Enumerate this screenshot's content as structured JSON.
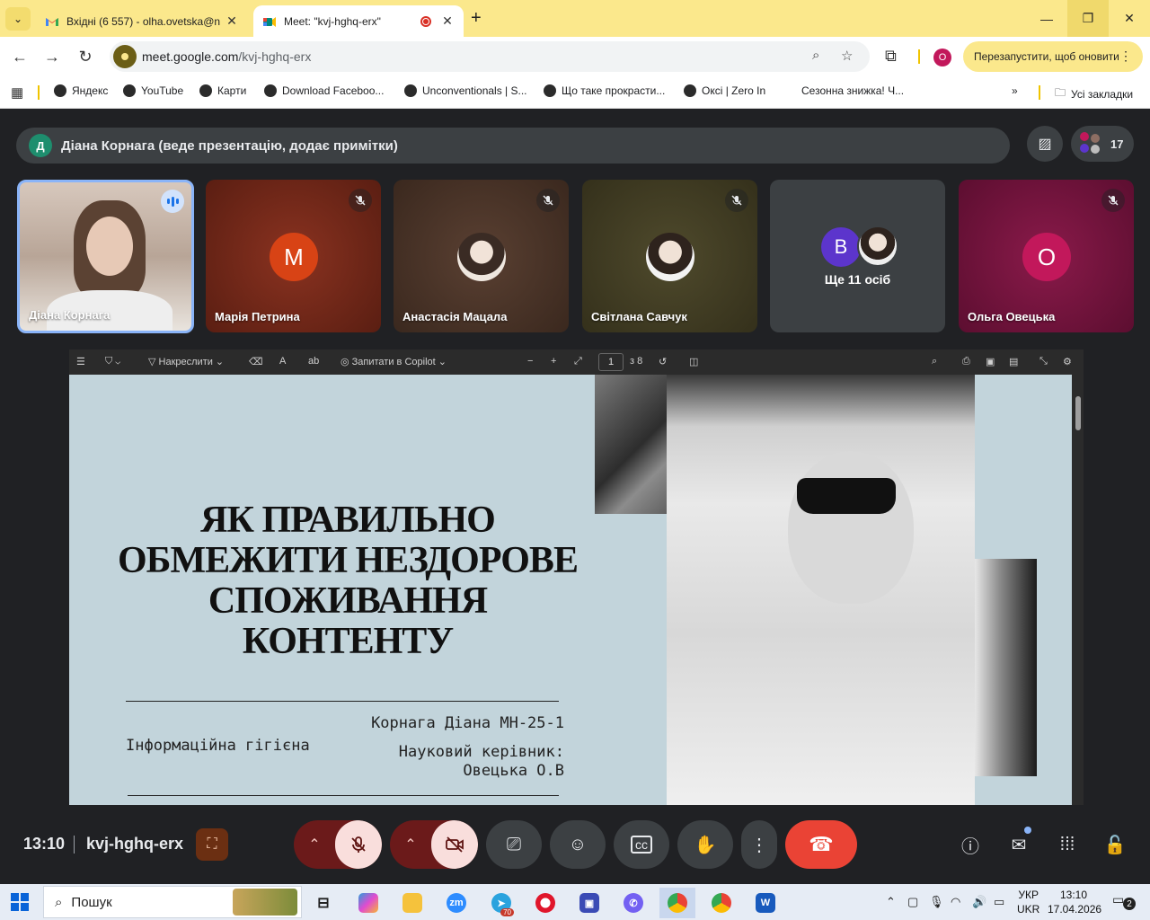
{
  "browser": {
    "tabs": [
      {
        "title": "Вхідні (6 557) - olha.ovetska@n",
        "favicon": "gmail-icon"
      },
      {
        "title": "Meet: \"kvj-hghq-erx\"",
        "favicon": "meet-icon",
        "recording": true
      }
    ],
    "url_host": "meet.google.com",
    "url_path": "/kvj-hghq-erx",
    "profile_initial": "О",
    "restart_label": "Перезапустити, щоб оновити",
    "bookmarks": [
      "Яндекс",
      "YouTube",
      "Карти",
      "Download Faceboo...",
      "Unconventionals | S...",
      "Що таке прокрасти...",
      "Оксі | Zero In",
      "Сезонна знижка! Ч..."
    ],
    "all_bookmarks": "Усі закладки"
  },
  "meet": {
    "presenter_initial": "Д",
    "presenter_text": "Діана Корнага (веде презентацію, додає примітки)",
    "participant_count": "17",
    "tiles": [
      {
        "name": "Діана Корнага",
        "type": "video",
        "speaking": true
      },
      {
        "name": "Марія Петрина",
        "type": "letter",
        "letter": "M",
        "avatar_color": "#d84315",
        "muted": true,
        "bg": "#6d2416"
      },
      {
        "name": "Анастасія Мацала",
        "type": "photo",
        "muted": true,
        "bg": "#4a3426"
      },
      {
        "name": "Світлана Савчук",
        "type": "photo",
        "muted": true,
        "bg": "#3f3a22"
      },
      {
        "name": "Ще 11 осіб",
        "type": "group",
        "letter": "B",
        "avatar_color": "#5c35cc",
        "bg": "#3c4043"
      },
      {
        "name": "Ольга Овецька",
        "type": "letter",
        "letter": "O",
        "avatar_color": "#c2185b",
        "muted": true,
        "bg": "#6a1038"
      }
    ],
    "time": "13:10",
    "code": "kvj-hghq-erx"
  },
  "pdf_viewer": {
    "draw_label": "Накреслити",
    "copilot_label": "Запитати в Copilot",
    "page_current": "1",
    "page_total": "з 8"
  },
  "slide": {
    "title_lines": [
      "ЯК ПРАВИЛЬНО",
      "ОБМЕЖИТИ НЕЗДОРОВЕ",
      "СПОЖИВАННЯ",
      "КОНТЕНТУ"
    ],
    "subject": "Інформаційна гігієна",
    "author": "Корнага Діана МН-25-1",
    "supervisor_label": "Науковий керівник:",
    "supervisor_name": "Овецька О.В"
  },
  "taskbar": {
    "search_placeholder": "Пошук",
    "telegram_badge": "70",
    "language_line1": "УКР",
    "language_line2": "UKR",
    "time": "13:10",
    "date": "17.04.2026",
    "notifications": "2"
  }
}
